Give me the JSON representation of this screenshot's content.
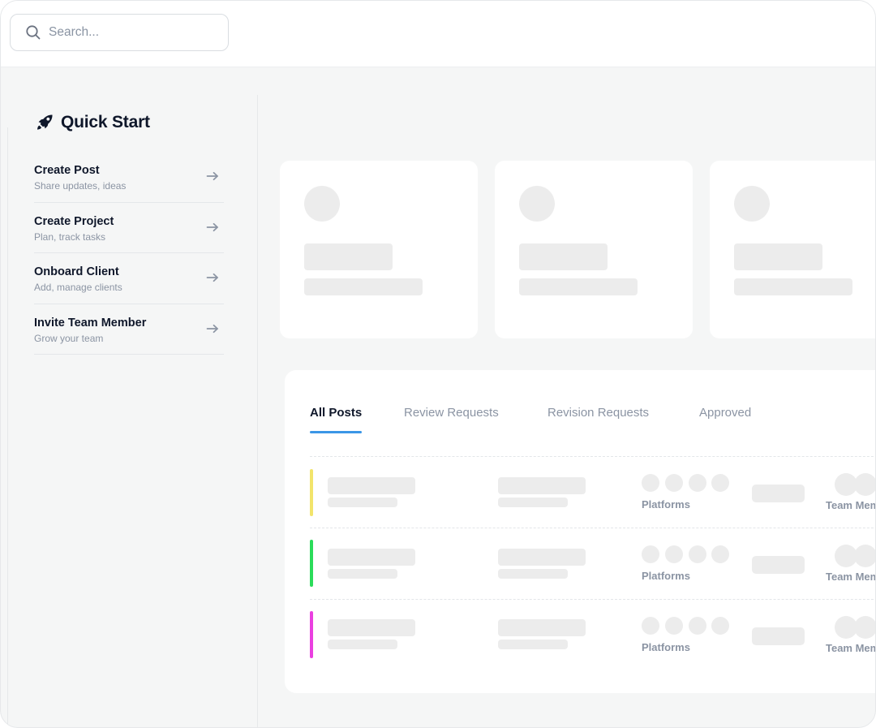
{
  "search": {
    "placeholder": "Search..."
  },
  "quick_start": {
    "title": "Quick Start",
    "items": [
      {
        "title": "Create Post",
        "subtitle": "Share updates, ideas"
      },
      {
        "title": "Create Project",
        "subtitle": "Plan, track tasks"
      },
      {
        "title": "Onboard Client",
        "subtitle": "Add, manage clients"
      },
      {
        "title": "Invite Team Member",
        "subtitle": "Grow your team"
      }
    ]
  },
  "tabs": [
    {
      "label": "All Posts",
      "active": true
    },
    {
      "label": "Review Requests",
      "active": false
    },
    {
      "label": "Revision Requests",
      "active": false
    },
    {
      "label": "Approved",
      "active": false
    }
  ],
  "posts": [
    {
      "color": "#f2e46b",
      "platforms_label": "Platforms",
      "team_label": "Team Members"
    },
    {
      "color": "#2bdc5a",
      "platforms_label": "Platforms",
      "team_label": "Team Members"
    },
    {
      "color": "#ea3fe0",
      "platforms_label": "Platforms",
      "team_label": "Team Members"
    }
  ],
  "colors": {
    "accent": "#3b96e6",
    "skeleton": "#ececec",
    "muted_text": "#8b94a3"
  },
  "icons": {
    "search": "search-icon",
    "quick_start": "rocket-icon",
    "item_action": "arrow-right-icon"
  }
}
